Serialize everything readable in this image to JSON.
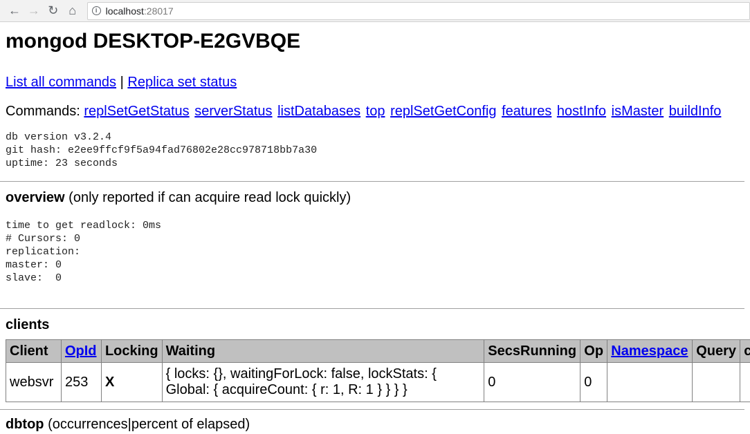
{
  "browser": {
    "back": "←",
    "forward": "→",
    "reload": "↻",
    "home": "⌂",
    "url_host": "localhost",
    "url_port": ":28017"
  },
  "heading": "mongod DESKTOP-E2GVBQE",
  "top_links": {
    "list_all": "List all commands",
    "separator": " | ",
    "replica_status": "Replica set status"
  },
  "commands": {
    "label": "Commands: ",
    "items": [
      "replSetGetStatus",
      "serverStatus",
      "listDatabases",
      "top",
      "replSetGetConfig",
      "features",
      "hostInfo",
      "isMaster",
      "buildInfo"
    ]
  },
  "version_info": {
    "line1": "db version v3.2.4",
    "line2": "git hash: e2ee9ffcf9f5a94fad76802e28cc978718bb7a30",
    "line3": "uptime: 23 seconds"
  },
  "overview": {
    "title": "overview",
    "subtitle": " (only reported if can acquire read lock quickly)",
    "lines": [
      "time to get readlock: 0ms",
      "# Cursors: 0",
      "replication:",
      "master: 0",
      "slave:  0"
    ]
  },
  "clients": {
    "title": "clients",
    "headers": [
      "Client",
      "OpId",
      "Locking",
      "Waiting",
      "SecsRunning",
      "Op",
      "Namespace",
      "Query",
      "cl"
    ],
    "rows": [
      {
        "client": "websvr",
        "opid": "253",
        "locking": "X",
        "waiting_line1": "{ locks: {}, waitingForLock: false, lockStats: {",
        "waiting_line2": "Global: { acquireCount: { r: 1, R: 1 } } } }",
        "secs": "0",
        "op": "0",
        "namespace": "",
        "query": "",
        "extra": ""
      }
    ]
  },
  "dbtop": {
    "title": "dbtop",
    "subtitle": " (occurrences|percent of elapsed)"
  }
}
